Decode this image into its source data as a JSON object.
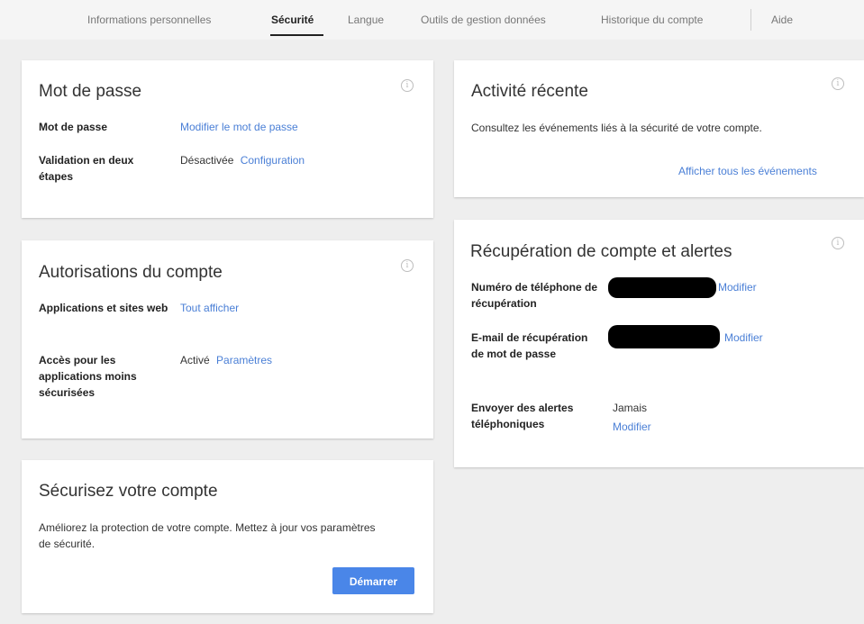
{
  "nav": {
    "tabs": [
      {
        "label": "Informations personnelles"
      },
      {
        "label": "Sécurité"
      },
      {
        "label": "Langue"
      },
      {
        "label": "Outils de gestion données"
      },
      {
        "label": "Historique du compte"
      },
      {
        "label": "Aide"
      }
    ],
    "active_tab": "Sécurité"
  },
  "password_card": {
    "title": "Mot de passe",
    "rows": [
      {
        "label": "Mot de passe",
        "link": "Modifier le mot de passe"
      },
      {
        "label": "Validation en deux étapes",
        "status": "Désactivée",
        "link": "Configuration"
      }
    ]
  },
  "permissions_card": {
    "title": "Autorisations du compte",
    "rows": [
      {
        "label": "Applications et sites web",
        "link": "Tout afficher"
      },
      {
        "label": "Accès pour les applications moins sécurisées",
        "status": "Activé",
        "link": "Paramètres"
      }
    ]
  },
  "secure_card": {
    "title": "Sécurisez votre compte",
    "description": "Améliorez la protection de votre compte. Mettez à jour vos paramètres de sécurité.",
    "button_label": "Démarrer"
  },
  "activity_card": {
    "title": "Activité récente",
    "description": "Consultez les événements liés à la sécurité de votre compte.",
    "link": "Afficher tous les événements"
  },
  "recovery_card": {
    "title": "Récupération de compte et alertes",
    "rows": [
      {
        "label": "Numéro de téléphone de récupération",
        "link": "Modifier"
      },
      {
        "label": "E-mail de récupération de mot de passe",
        "link": "Modifier"
      },
      {
        "label": "Envoyer des alertes téléphoniques",
        "status": "Jamais",
        "link": "Modifier"
      }
    ]
  },
  "colors": {
    "link": "#4a7fd6",
    "primary_button": "#4a86e8",
    "background": "#eeeeee",
    "card": "#ffffff"
  },
  "icons": {
    "card_info": "info-circle-icon"
  }
}
